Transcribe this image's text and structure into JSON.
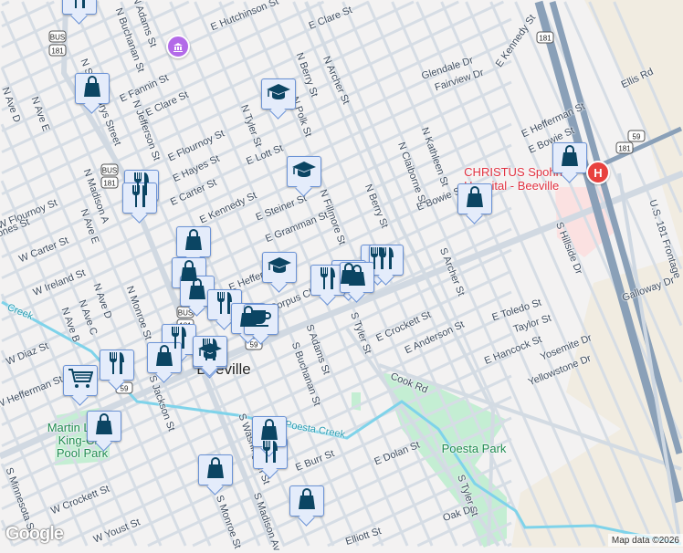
{
  "map": {
    "attribution": "Map data ©2026",
    "logo": "Google",
    "colors": {
      "background": "#f3f2f2",
      "road": "#d3dbe3",
      "highway": "#8aa0b8",
      "park": "#c4eed3",
      "creek": "#7fd3ea",
      "pin_icon": "#0b4563",
      "pin_bg": "#e4ecfb",
      "museum": "#b36ae8",
      "hospital": "#e8423f"
    },
    "shields": [
      "BUS",
      "181",
      "BUS",
      "181",
      "BUS",
      "181",
      "59",
      "59",
      "181",
      "181",
      "59"
    ],
    "labels": [
      "N Saint Marys Street",
      "N Buchanan St",
      "N Adams St",
      "E Hutchinson St",
      "E Clare St",
      "E Fannin St",
      "E Clare St",
      "N Jefferson St",
      "E Flournoy St",
      "E Hayes St",
      "E Carter St",
      "E Kennedy St",
      "E Steiner St",
      "E Gramman St",
      "N Tyler St",
      "N Berry St",
      "N Polk St",
      "N Archer St",
      "E Lott St",
      "N Madison A",
      "N Ave E",
      "N Ave E",
      "N Ave D",
      "W Flournoy St",
      "W Carter St",
      "W Ireland St",
      "N Ave D",
      "N Ave C",
      "N Ave B",
      "N Monroe St",
      "W Diaz St",
      "W Hefferman St",
      "S Jackson St",
      "S Minnesota St",
      "W Crockett St",
      "W Youst St",
      "S Monroe St",
      "S Madison Av",
      "S Washington St",
      "E Burr St",
      "S Buchanan St",
      "S Adams St",
      "E Dolan St",
      "S Tyler St",
      "S Tyler St",
      "E Crockett St",
      "E Anderson St",
      "E Toledo St",
      "Taylor St",
      "E Hancock St",
      "Yosemite Dr",
      "Yellowstone Dr",
      "Galloway Dr",
      "Cook Rd",
      "Oak Dr",
      "Elliott St",
      "Poesta Creek",
      "Glendale Dr",
      "Fairview Dr",
      "E Kennedy St",
      "Ellis Rd",
      "E Hefferman St",
      "E Bowie St",
      "E Bowie St",
      "N Kathleen St",
      "N Claiborne St",
      "N Berry St",
      "S Archer St",
      "S Hillside Dr",
      "U.S. 181 Frontage",
      "E Hefferman St",
      "E Corpus Christi St",
      "N Fillmore St",
      "Jones St",
      "Creek",
      "Poesta Park",
      "Martin Luther\nKing-City\nPool Park",
      "Beeville",
      "CHRISTUS Spohn\nHospital - Beeville"
    ],
    "pois": [
      {
        "type": "restaurant"
      },
      {
        "type": "shopping"
      },
      {
        "type": "school"
      },
      {
        "type": "school"
      },
      {
        "type": "restaurant"
      },
      {
        "type": "restaurant"
      },
      {
        "type": "shopping"
      },
      {
        "type": "shopping"
      },
      {
        "type": "school"
      },
      {
        "type": "restaurant"
      },
      {
        "type": "restaurant"
      },
      {
        "type": "shopping"
      },
      {
        "type": "restaurant"
      },
      {
        "type": "shopping"
      },
      {
        "type": "shopping"
      },
      {
        "type": "shopping"
      },
      {
        "type": "shopping"
      },
      {
        "type": "school"
      },
      {
        "type": "restaurant"
      },
      {
        "type": "restaurant"
      },
      {
        "type": "shopping"
      },
      {
        "type": "cafe"
      },
      {
        "type": "shopping"
      },
      {
        "type": "restaurant"
      },
      {
        "type": "restaurant"
      },
      {
        "type": "grocery"
      },
      {
        "type": "shopping"
      },
      {
        "type": "restaurant"
      },
      {
        "type": "shopping"
      },
      {
        "type": "shopping"
      }
    ],
    "museum_icon": "museum-icon",
    "hospital_icon": "H"
  }
}
